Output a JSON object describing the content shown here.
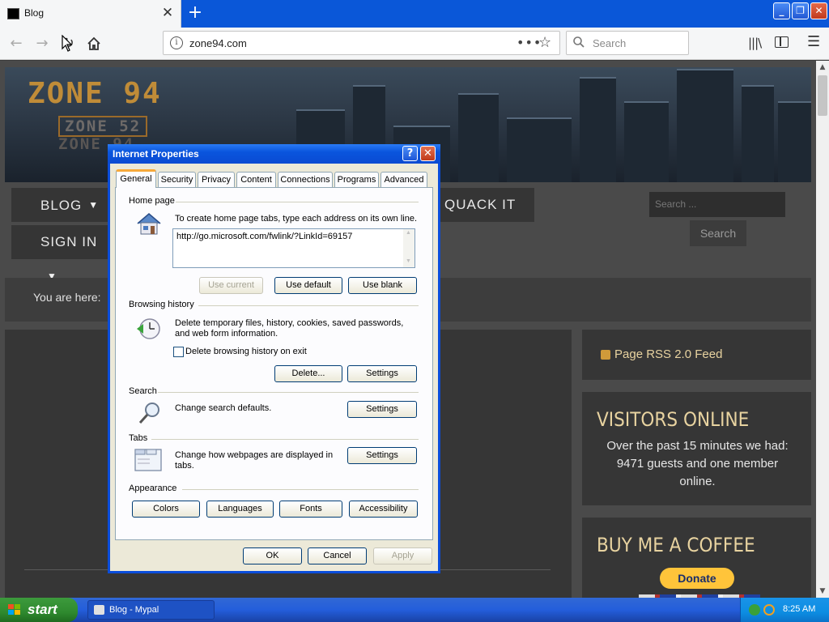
{
  "browser": {
    "tab_title": "Blog",
    "url": "zone94.com",
    "search_placeholder": "Search",
    "url_actions": "•••"
  },
  "website": {
    "logo_main": "ZONE 94",
    "logo_sub1": "ZONE 52",
    "logo_sub2": "ZONE 94",
    "menu_blog": "BLOG",
    "menu_signin": "SIGN IN",
    "menu_quack": "QUACK IT",
    "search_placeholder": "Search ...",
    "search_button": "Search",
    "breadcrumb": "You are here:",
    "rss_link": "Page RSS 2.0 Feed",
    "visitors_title": "VISITORS ONLINE",
    "visitors_body": "Over the past 15 minutes we had: 9471 guests and one member online.",
    "coffee_title": "BUY ME A COFFEE",
    "donate_label": "Donate"
  },
  "dialog": {
    "title": "Internet Properties",
    "tabs": [
      "General",
      "Security",
      "Privacy",
      "Content",
      "Connections",
      "Programs",
      "Advanced"
    ],
    "active_tab": "General",
    "home_page": {
      "heading": "Home page",
      "description": "To create home page tabs, type each address on its own line.",
      "value": "http://go.microsoft.com/fwlink/?LinkId=69157",
      "use_current": "Use current",
      "use_default": "Use default",
      "use_blank": "Use blank"
    },
    "browsing_history": {
      "heading": "Browsing history",
      "description": "Delete temporary files, history, cookies, saved passwords, and web form information.",
      "checkbox_label": "Delete browsing history on exit",
      "checkbox_checked": false,
      "delete_button": "Delete...",
      "settings_button": "Settings"
    },
    "search": {
      "heading": "Search",
      "description": "Change search defaults.",
      "settings_button": "Settings"
    },
    "tabs_section": {
      "heading": "Tabs",
      "description": "Change how webpages are displayed in tabs.",
      "settings_button": "Settings"
    },
    "appearance": {
      "heading": "Appearance",
      "colors": "Colors",
      "languages": "Languages",
      "fonts": "Fonts",
      "accessibility": "Accessibility"
    },
    "ok": "OK",
    "cancel": "Cancel",
    "apply": "Apply"
  },
  "taskbar": {
    "start_label": "start",
    "task_item": "Blog - Mypal",
    "clock": "8:25 AM"
  },
  "colors": {
    "xp_blue": "#0a4ddb",
    "site_accent": "#e8d3a0",
    "donate_yellow": "#ffc43a"
  }
}
